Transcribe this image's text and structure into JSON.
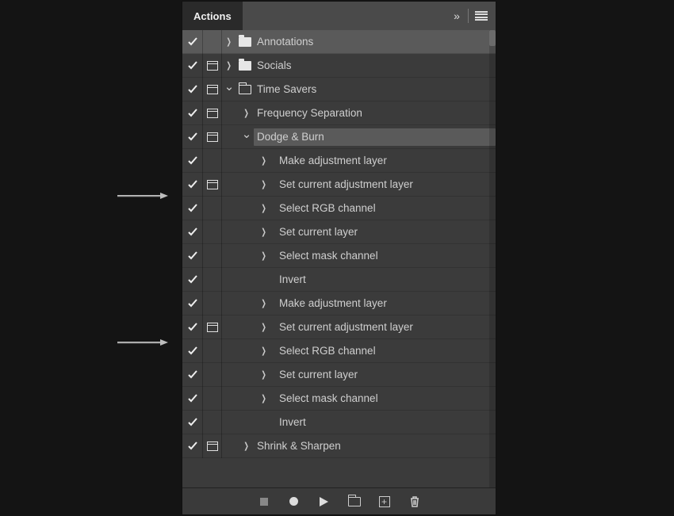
{
  "panel": {
    "title": "Actions"
  },
  "rows": [
    {
      "checked": true,
      "dialog": false,
      "disclosure": "closed",
      "folder": "closed",
      "indent": 0,
      "label": "Annotations",
      "selected": "head"
    },
    {
      "checked": true,
      "dialog": true,
      "disclosure": "closed",
      "folder": "closed",
      "indent": 0,
      "label": "Socials"
    },
    {
      "checked": true,
      "dialog": true,
      "disclosure": "open",
      "folder": "open",
      "indent": 0,
      "label": "Time Savers"
    },
    {
      "checked": true,
      "dialog": true,
      "disclosure": "closed",
      "folder": null,
      "indent": 1,
      "label": "Frequency Separation"
    },
    {
      "checked": true,
      "dialog": true,
      "disclosure": "open",
      "folder": null,
      "indent": 1,
      "label": "Dodge & Burn",
      "selected": "row"
    },
    {
      "checked": true,
      "dialog": false,
      "disclosure": "closed",
      "folder": null,
      "indent": 2,
      "label": "Make adjustment layer"
    },
    {
      "checked": true,
      "dialog": true,
      "disclosure": "closed",
      "folder": null,
      "indent": 2,
      "label": "Set current adjustment layer"
    },
    {
      "checked": true,
      "dialog": false,
      "disclosure": "closed",
      "folder": null,
      "indent": 2,
      "label": "Select RGB channel"
    },
    {
      "checked": true,
      "dialog": false,
      "disclosure": "closed",
      "folder": null,
      "indent": 2,
      "label": "Set current layer"
    },
    {
      "checked": true,
      "dialog": false,
      "disclosure": "closed",
      "folder": null,
      "indent": 2,
      "label": "Select mask channel"
    },
    {
      "checked": true,
      "dialog": false,
      "disclosure": "none",
      "folder": null,
      "indent": 2,
      "label": "Invert"
    },
    {
      "checked": true,
      "dialog": false,
      "disclosure": "closed",
      "folder": null,
      "indent": 2,
      "label": "Make adjustment layer"
    },
    {
      "checked": true,
      "dialog": true,
      "disclosure": "closed",
      "folder": null,
      "indent": 2,
      "label": "Set current adjustment layer"
    },
    {
      "checked": true,
      "dialog": false,
      "disclosure": "closed",
      "folder": null,
      "indent": 2,
      "label": "Select RGB channel"
    },
    {
      "checked": true,
      "dialog": false,
      "disclosure": "closed",
      "folder": null,
      "indent": 2,
      "label": "Set current layer"
    },
    {
      "checked": true,
      "dialog": false,
      "disclosure": "closed",
      "folder": null,
      "indent": 2,
      "label": "Select mask channel"
    },
    {
      "checked": true,
      "dialog": false,
      "disclosure": "none",
      "folder": null,
      "indent": 2,
      "label": "Invert"
    },
    {
      "checked": true,
      "dialog": true,
      "disclosure": "closed",
      "folder": null,
      "indent": 1,
      "label": "Shrink & Sharpen"
    }
  ]
}
